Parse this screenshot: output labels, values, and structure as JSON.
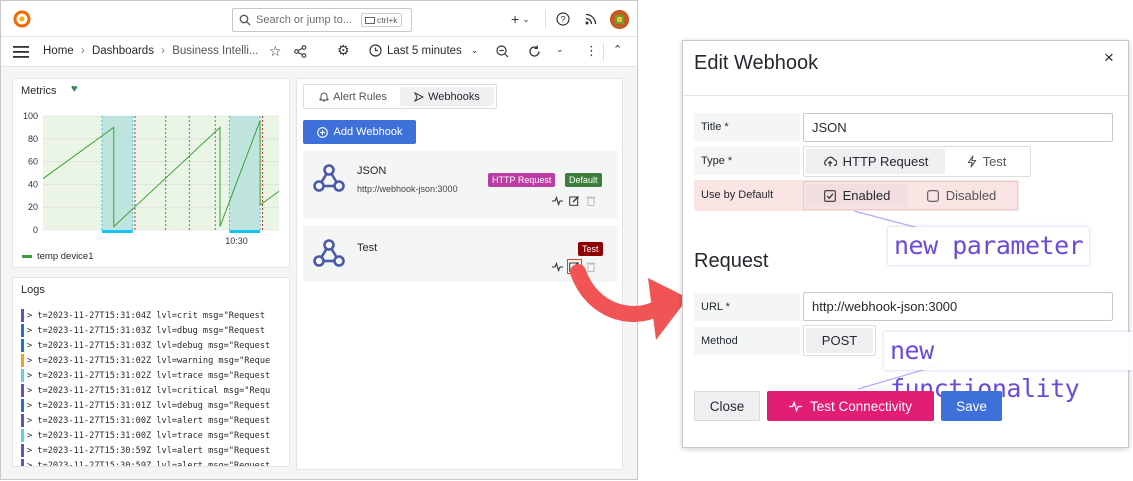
{
  "topbar": {
    "search_placeholder": "Search or jump to...",
    "shortcut": "ctrl+k",
    "plus": "+"
  },
  "breadcrumb": {
    "home": "Home",
    "sep": "›",
    "dashboards": "Dashboards",
    "current": "Business Intelli..."
  },
  "timepicker": {
    "label": "Last 5 minutes"
  },
  "metrics": {
    "title": "Metrics",
    "legend": "temp device1",
    "chart_data": {
      "type": "line",
      "title": "Metrics",
      "ylim": [
        0,
        100
      ],
      "yticks": [
        "100",
        "80",
        "60",
        "40",
        "20",
        "0"
      ],
      "xticks": [
        "10:30"
      ],
      "series": [
        {
          "name": "temp device1",
          "x": [
            0,
            0.3,
            0.3,
            0.75,
            0.75,
            0.92,
            0.92,
            1
          ],
          "y": [
            45,
            90,
            3,
            90,
            3,
            96,
            22,
            34
          ]
        }
      ]
    }
  },
  "logs": {
    "title": "Logs",
    "lines": [
      {
        "text": "> t=2023-11-27T15:31:04Z lvl=crit msg=\"Request",
        "color": "#6c4cc4"
      },
      {
        "text": "> t=2023-11-27T15:31:03Z lvl=dbug msg=\"Request",
        "color": "#1f6fd1"
      },
      {
        "text": "> t=2023-11-27T15:31:03Z lvl=debug msg=\"Request",
        "color": "#1f6fd1"
      },
      {
        "text": "> t=2023-11-27T15:31:02Z lvl=warning msg=\"Reque",
        "color": "#f2a21b"
      },
      {
        "text": "> t=2023-11-27T15:31:02Z lvl=trace msg=\"Request",
        "color": "#58d6d6"
      },
      {
        "text": "> t=2023-11-27T15:31:01Z lvl=critical msg=\"Requ",
        "color": "#6c4cc4"
      },
      {
        "text": "> t=2023-11-27T15:31:01Z lvl=debug msg=\"Request",
        "color": "#1f6fd1"
      },
      {
        "text": "> t=2023-11-27T15:31:00Z lvl=alert msg=\"Request",
        "color": "#6c4cc4"
      },
      {
        "text": "> t=2023-11-27T15:31:00Z lvl=trace msg=\"Request",
        "color": "#58d6d6"
      },
      {
        "text": "> t=2023-11-27T15:30:59Z lvl=alert msg=\"Request",
        "color": "#6c4cc4"
      },
      {
        "text": "> t=2023-11-27T15:30:59Z lvl=alert msg=\"Request",
        "color": "#6c4cc4"
      }
    ]
  },
  "webhooks_panel": {
    "tab_alert_rules": "Alert Rules",
    "tab_webhooks": "Webhooks",
    "add_button": "Add Webhook",
    "items": [
      {
        "name": "JSON",
        "url": "http://webhook-json:3000",
        "badge_type": "HTTP Request",
        "badge_default": "Default"
      },
      {
        "name": "Test",
        "badge_test": "Test"
      }
    ]
  },
  "modal": {
    "title": "Edit Webhook",
    "close": "×",
    "title_label": "Title *",
    "title_value": "JSON",
    "type_label": "Type *",
    "type_http": "HTTP Request",
    "type_test": "Test",
    "default_label": "Use by Default",
    "enabled": "Enabled",
    "disabled": "Disabled",
    "request_heading": "Request",
    "url_label": "URL *",
    "url_value": "http://webhook-json:3000",
    "method_label": "Method",
    "method_value": "POST",
    "close_button": "Close",
    "test_button": "Test Connectivity",
    "save_button": "Save"
  },
  "annotations": {
    "new_parameter": "new parameter",
    "new_functionality": "new functionality"
  },
  "colors": {
    "accent": "#3d71d9",
    "pink": "#e11d74",
    "purple_badge": "#b93da3",
    "green_badge": "#3e7d3a",
    "red_badge": "#8e0000",
    "arrow": "#f05454"
  }
}
